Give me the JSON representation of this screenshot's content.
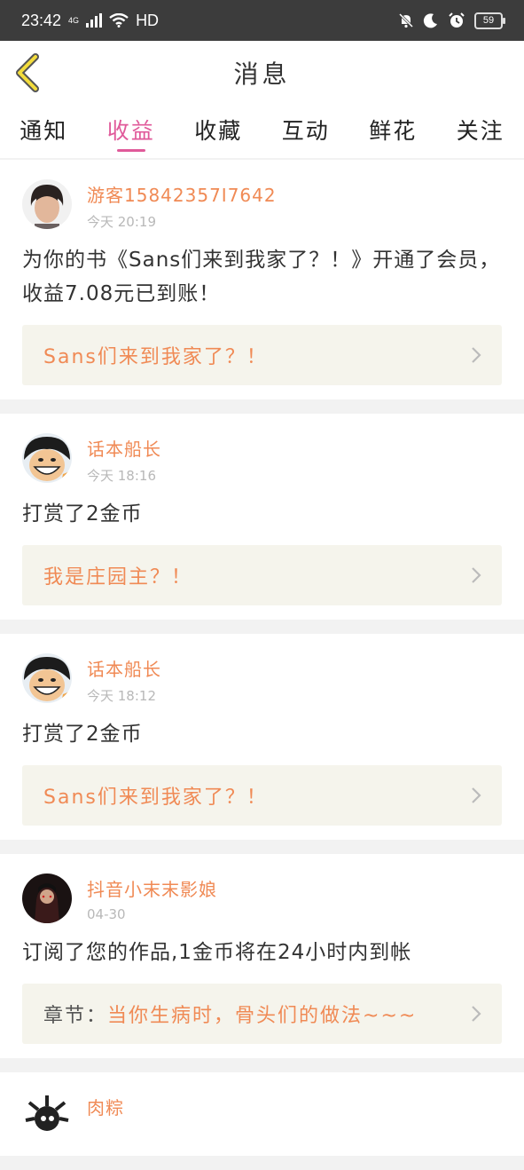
{
  "status": {
    "time": "23:42",
    "network": "4G",
    "hd": "HD",
    "battery": "59"
  },
  "header": {
    "title": "消息"
  },
  "tabs": [
    "通知",
    "收益",
    "收藏",
    "互动",
    "鲜花",
    "关注"
  ],
  "messages": [
    {
      "user": "游客15842357I7642",
      "time": "今天 20:19",
      "content": "为你的书《Sans们来到我家了？！》开通了会员，收益7.08元已到账！",
      "link_prefix": "",
      "link": "Sans们来到我家了？！"
    },
    {
      "user": "话本船长",
      "time": "今天 18:16",
      "content": "打赏了2金币",
      "link_prefix": "",
      "link": "我是庄园主？！"
    },
    {
      "user": "话本船长",
      "time": "今天 18:12",
      "content": "打赏了2金币",
      "link_prefix": "",
      "link": "Sans们来到我家了？！"
    },
    {
      "user": "抖音小末末影娘",
      "time": "04-30",
      "content": "订阅了您的作品,1金币将在24小时内到帐",
      "link_prefix": "章节：",
      "link": "当你生病时，骨头们的做法~~~"
    },
    {
      "user": "肉粽",
      "time": "",
      "content": "",
      "link_prefix": "",
      "link": ""
    }
  ],
  "colors": {
    "accent_pink": "#e05a9a",
    "accent_orange": "#f08a55",
    "link_bg": "#f5f4ec"
  }
}
